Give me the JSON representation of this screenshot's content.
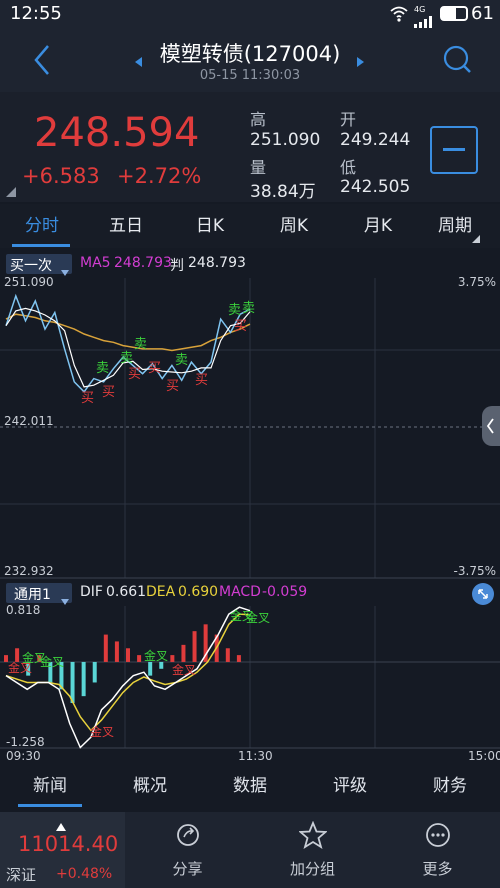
{
  "status": {
    "time": "12:55",
    "network": "4G",
    "battery": "61"
  },
  "nav": {
    "title": "模塑转债(127004)",
    "datetime": "05-15 11:30:03"
  },
  "quote": {
    "price": "248.594",
    "change": "+6.583",
    "change_pct": "+2.72%",
    "high_label": "高",
    "high": "251.090",
    "open_label": "开",
    "open": "249.244",
    "volume_label": "量",
    "volume": "38.84万",
    "low_label": "低",
    "low": "242.505"
  },
  "tabs": [
    "分时",
    "五日",
    "日K",
    "周K",
    "月K",
    "周期"
  ],
  "chart": {
    "indicator": "买一次",
    "ma5_label": "MA5",
    "ma5_value": "248.793",
    "judge_label": "判",
    "judge_value": "248.793",
    "price_top": "251.090",
    "price_mid": "242.011",
    "price_bottom": "232.932",
    "pct_top": "3.75%",
    "pct_bottom": "-3.75%",
    "buy_mark": "买",
    "sell_mark": "卖"
  },
  "macd": {
    "indicator": "通用1",
    "dif_label": "DIF",
    "dif": "0.661",
    "dea_label": "DEA",
    "dea": "0.690",
    "macd_label": "MACD",
    "macd": "-0.059",
    "top": "0.818",
    "bottom": "-1.258",
    "time_start": "09:30",
    "time_mid": "11:30",
    "time_end": "15:00",
    "golden_cross": "金叉"
  },
  "tabs2": [
    "新闻",
    "概况",
    "数据",
    "评级",
    "财务"
  ],
  "bottom": {
    "index_value": "11014.40",
    "index_name": "深证",
    "index_pct": "+0.48%",
    "share": "分享",
    "add_group": "加分组",
    "more": "更多"
  },
  "colors": {
    "red": "#e03c3c",
    "green": "#3bd13b",
    "blue": "#3a8de0",
    "ma5": "#d23dd2",
    "avg": "#d8a23a",
    "dea": "#e8d23c",
    "macd": "#d33dd2",
    "cyan": "#5ad6d6"
  },
  "chart_data": {
    "type": "line",
    "price_series": [
      248.2,
      250.0,
      248.5,
      249.7,
      248.0,
      249.0,
      246.8,
      244.8,
      244.2,
      245.0,
      244.8,
      245.6,
      246.3,
      245.8,
      245.3,
      245.9,
      245.0,
      245.8,
      244.9,
      246.0,
      245.3,
      246.0,
      248.6,
      247.8,
      248.9,
      249.2
    ],
    "avg_series": [
      248.6,
      248.9,
      248.8,
      248.7,
      248.5,
      248.4,
      248.2,
      248.0,
      247.7,
      247.5,
      247.3,
      247.2,
      247.0,
      246.9,
      246.8,
      246.8,
      246.8,
      246.7,
      246.8,
      246.9,
      247.0,
      247.3,
      247.5,
      247.8,
      248.0,
      248.3
    ],
    "ylim": [
      232.932,
      251.09
    ],
    "macd_ylim": [
      -1.258,
      0.818
    ],
    "dif_series": [
      -0.2,
      -0.3,
      -0.4,
      -0.3,
      -0.3,
      -0.4,
      -0.9,
      -1.25,
      -1.1,
      -0.7,
      -0.55,
      -0.35,
      -0.2,
      -0.15,
      -0.35,
      -0.4,
      -0.3,
      -0.2,
      -0.1,
      0.15,
      0.4,
      0.7,
      0.8,
      0.75
    ],
    "dea_series": [
      -0.2,
      -0.25,
      -0.3,
      -0.3,
      -0.3,
      -0.33,
      -0.5,
      -0.8,
      -1.0,
      -0.85,
      -0.65,
      -0.45,
      -0.3,
      -0.22,
      -0.28,
      -0.33,
      -0.3,
      -0.25,
      -0.15,
      0.0,
      0.25,
      0.55,
      0.7,
      0.69
    ],
    "macd_bars": [
      0.1,
      0.2,
      -0.2,
      0.1,
      -0.3,
      -0.4,
      -0.6,
      -0.5,
      -0.3,
      0.4,
      0.3,
      0.2,
      0.1,
      -0.2,
      -0.1,
      0.1,
      0.25,
      0.45,
      0.55,
      0.4,
      0.2,
      0.1,
      0.0
    ]
  }
}
